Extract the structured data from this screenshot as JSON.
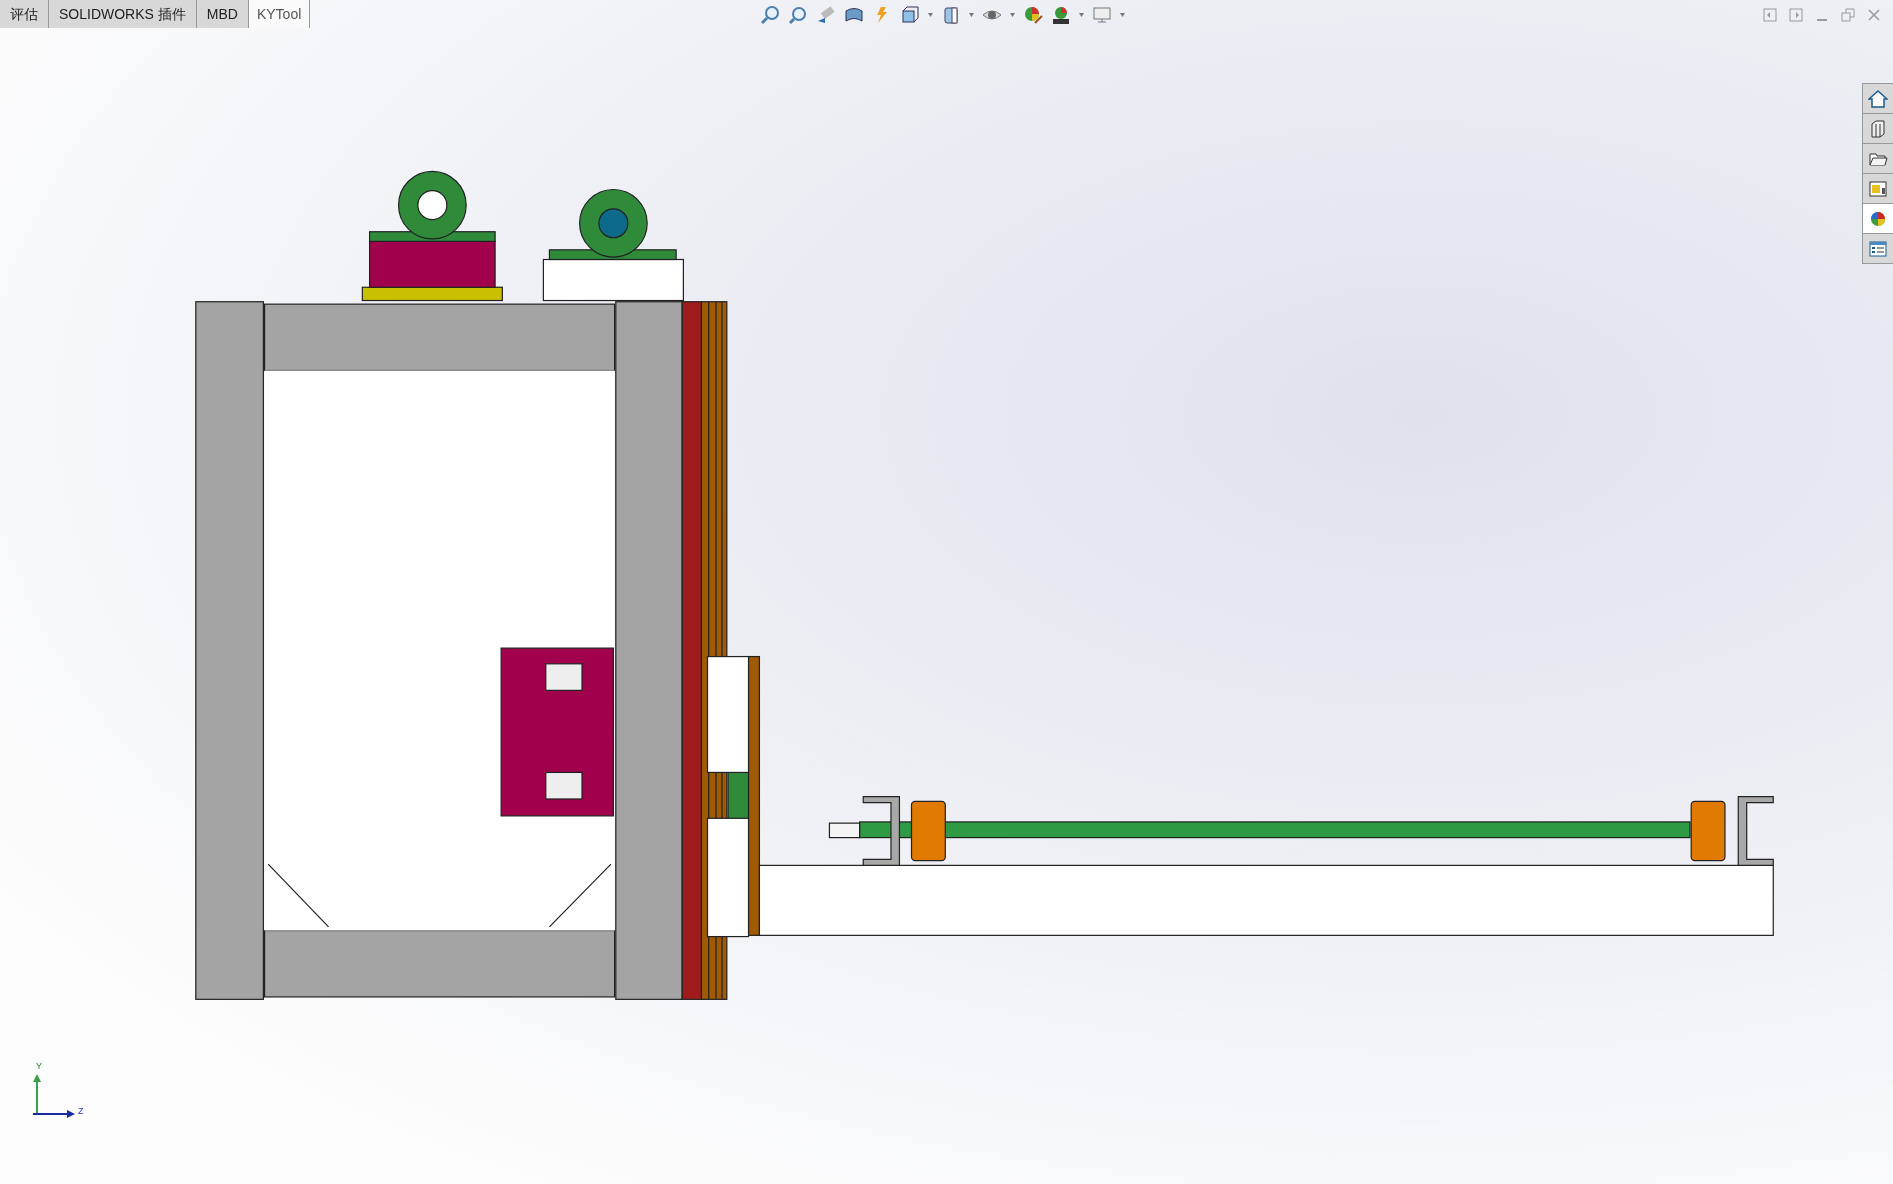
{
  "tabs": [
    {
      "label": "评估",
      "selected": false
    },
    {
      "label": "SOLIDWORKS 插件",
      "selected": false
    },
    {
      "label": "MBD",
      "selected": false
    },
    {
      "label": "KYTool",
      "selected": true
    }
  ],
  "task_pane": [
    {
      "selected": false
    },
    {
      "selected": false
    },
    {
      "selected": false
    },
    {
      "selected": false
    },
    {
      "selected": true
    },
    {
      "selected": false
    }
  ],
  "triad": {
    "y_label": "Y",
    "z_label": "Z"
  }
}
